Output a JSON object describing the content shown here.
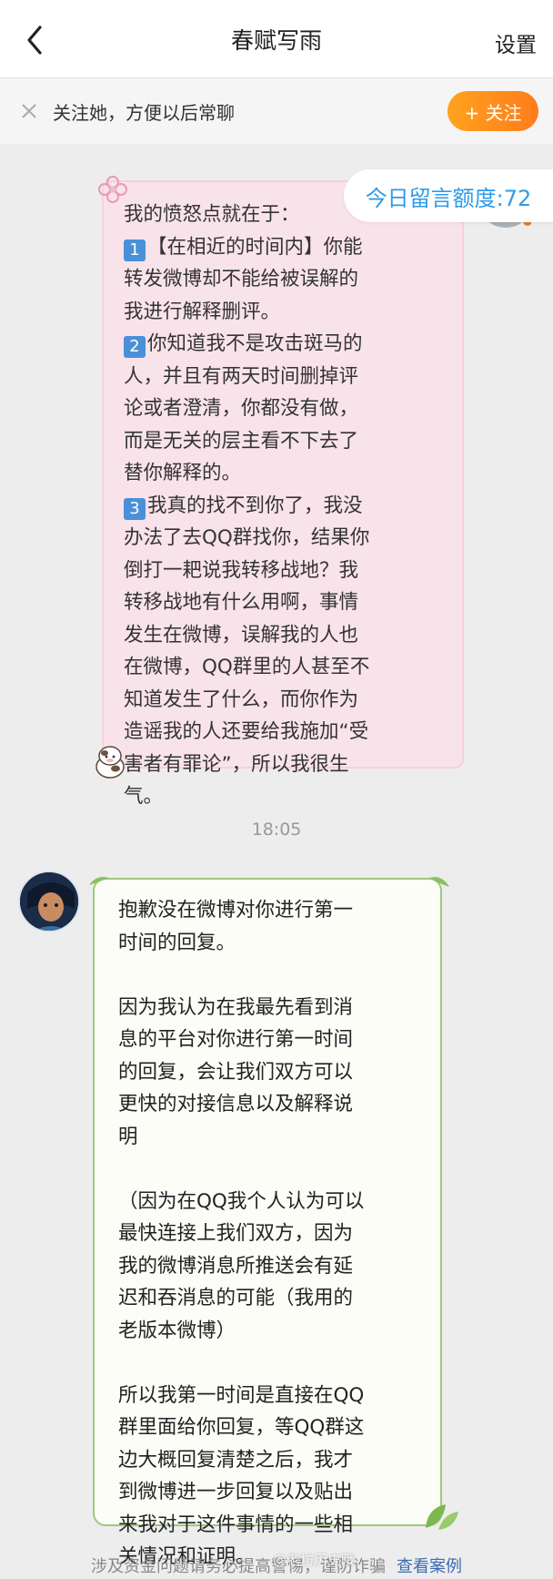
{
  "header": {
    "title": "春赋写雨",
    "settings_label": "设置"
  },
  "follow_bar": {
    "text": "关注她，方便以后常聊",
    "button_label": "+ 关注"
  },
  "quota": {
    "text": "今日留言额度:72"
  },
  "messages": [
    {
      "side": "right",
      "lines": [
        "我的愤怒点就在于：",
        "【在相近的时间内】你能",
        "转发微博却不能给被误解的",
        "我进行解释删评。",
        "你知道我不是攻击斑马的",
        "人，并且有两天时间删掉评",
        "论或者澄清，你都没有做，",
        "而是无关的层主看不下去了",
        "替你解释的。",
        "我真的找不到你了，我没",
        "办法了去QQ群找你，结果你",
        "倒打一耙说我转移战地？我",
        "转移战地有什么用啊，事情",
        "发生在微博，误解我的人也",
        "在微博，QQ群里的人甚至不",
        "知道发生了什么，而你作为",
        "造谣我的人还要给我施加“受",
        "害者有罪论”，所以我很生",
        "气。"
      ],
      "badges": [
        "1",
        "2",
        "3"
      ]
    },
    {
      "side": "left",
      "lines": [
        "抱歉没在微博对你进行第一",
        "时间的回复。",
        "",
        "因为我认为在我最先看到消",
        "息的平台对你进行第一时间",
        "的回复，会让我们双方可以",
        "更快的对接信息以及解释说",
        "明",
        "",
        "（因为在QQ我个人认为可以",
        "最快连接上我们双方，因为",
        "我的微博消息所推送会有延",
        "迟和吞消息的可能（我用的",
        "老版本微博）",
        "",
        "所以我第一时间是直接在QQ",
        "群里面给你回复，等QQ群这",
        "边大概回复清楚之后，我才",
        "到微博进一步回复以及贴出",
        "来我对于这件事情的一些相",
        "关情况和证明。"
      ]
    }
  ],
  "time_divider": "18:05",
  "bottom_notice": {
    "text": "涉及资金问题请务必提高警惕，谨防诈骗",
    "link": "查看案例"
  },
  "watermark": "@老坊历史哦",
  "colors": {
    "accent_orange": "#ff8c1e",
    "quota_blue": "#2f9be8",
    "pink_bubble": "#f9e3ea",
    "green_border": "#9fc87d",
    "badge_blue": "#4a90d9",
    "link_blue": "#3d6bb3"
  },
  "icons": [
    "back-arrow-icon",
    "close-icon",
    "plus-icon",
    "flower-sticker-icon",
    "cow-sticker-icon",
    "leaf-icon"
  ]
}
